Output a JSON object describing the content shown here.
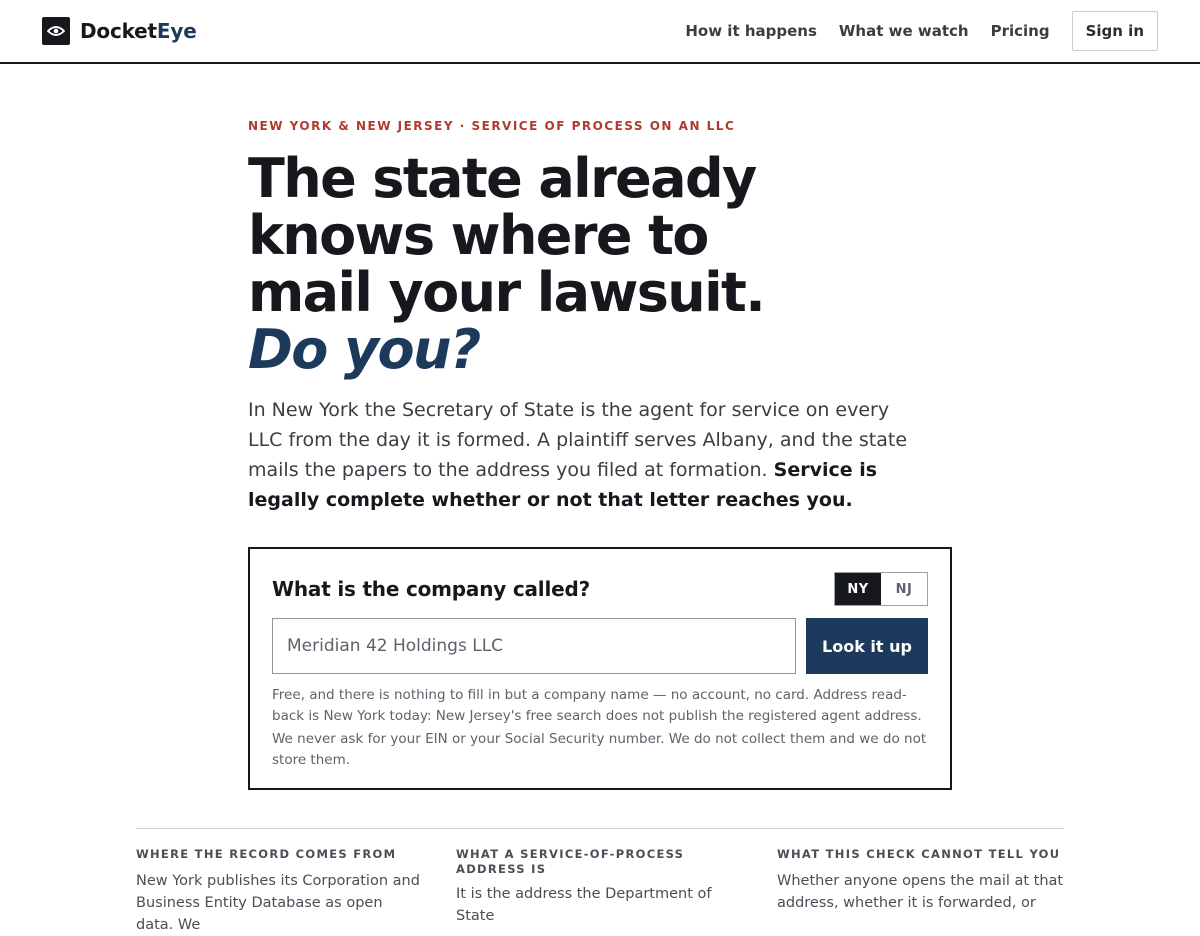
{
  "header": {
    "brand_prefix": "Docket",
    "brand_suffix": "Eye",
    "brand_icon": "eye-icon",
    "nav": [
      {
        "label": "How it happens"
      },
      {
        "label": "What we watch"
      },
      {
        "label": "Pricing"
      }
    ],
    "signin_label": "Sign in"
  },
  "hero": {
    "eyebrow": "NEW YORK & NEW JERSEY · SERVICE OF PROCESS ON AN LLC",
    "headline_lines": [
      "The state already",
      "knows where to",
      "mail your lawsuit."
    ],
    "headline_question": "Do you?",
    "lede_text": "In New York the Secretary of State is the agent for service on every LLC from the day it is formed. A plaintiff serves Albany, and the state mails the papers to the address you filed at formation.",
    "lede_bold": "Service is legally complete whether or not that letter reaches you."
  },
  "lookup": {
    "title": "What is the company called?",
    "states": [
      {
        "label": "NY",
        "selected": true
      },
      {
        "label": "NJ",
        "selected": false
      }
    ],
    "input_placeholder": "Meridian 42 Holdings LLC",
    "input_value": "",
    "submit_label": "Look it up",
    "note_1": "Free, and there is nothing to fill in but a company name — no account, no card. Address read-back is New York today: New Jersey's free search does not publish the registered agent address.",
    "note_2": "We never ask for your EIN or your Social Security number. We do not collect them and we do not store them."
  },
  "info": [
    {
      "heading": "WHERE THE RECORD COMES FROM",
      "body": "New York publishes its Corporation and Business Entity Database as open data. We"
    },
    {
      "heading": "WHAT A SERVICE-OF-PROCESS ADDRESS IS",
      "body": "It is the address the Department of State"
    },
    {
      "heading": "WHAT THIS CHECK CANNOT TELL YOU",
      "body": "Whether anyone opens the mail at that address, whether it is forwarded, or"
    }
  ],
  "colors": {
    "ink": "#16181d",
    "accent_navy": "#1d3a5c",
    "eyebrow_red": "#b03a2e",
    "muted": "#5d626b"
  }
}
